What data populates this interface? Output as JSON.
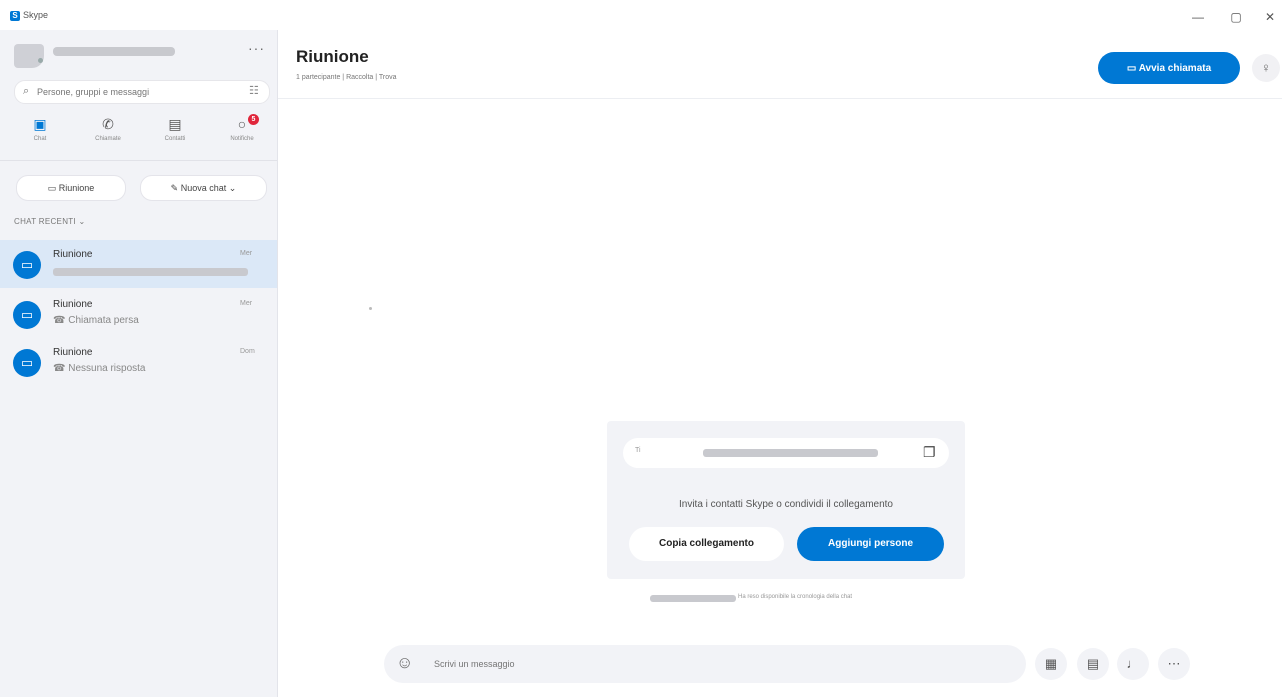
{
  "window": {
    "title": "Skype",
    "logo": "S",
    "controls": {
      "minimize": "—",
      "maximize": "▢",
      "close": "✕"
    }
  },
  "sidebar": {
    "more": "···",
    "search": {
      "placeholder": "Persone, gruppi e messaggi"
    },
    "nav": [
      {
        "label": "Chat",
        "icon": "chat-icon",
        "active": true
      },
      {
        "label": "Chiamate",
        "icon": "phone-icon"
      },
      {
        "label": "Contatti",
        "icon": "contacts-icon"
      },
      {
        "label": "Notifiche",
        "icon": "bell-icon",
        "badge": "5"
      }
    ],
    "meeting_button": "Riunione",
    "new_chat_button": "Nuova chat",
    "recent_header": "CHAT RECENTI",
    "chats": [
      {
        "title": "Riunione",
        "subtitle": "",
        "time": "Mer",
        "active": true
      },
      {
        "title": "Riunione",
        "subtitle": "Chiamata persa",
        "time": "Mer"
      },
      {
        "title": "Riunione",
        "subtitle": "Nessuna risposta",
        "time": "Dom"
      }
    ]
  },
  "main": {
    "title": "Riunione",
    "subtitle": "1 partecipante  |  Raccolta  |  Trova",
    "call_button": "Avvia chiamata",
    "invite": {
      "link_prefix": "Ti",
      "text": "Invita i contatti Skype o condividi il collegamento",
      "copy_button": "Copia collegamento",
      "add_button": "Aggiungi persone"
    },
    "note": "Ha reso disponibile la cronologia della chat",
    "compose": {
      "placeholder": "Scrivi un messaggio"
    }
  }
}
